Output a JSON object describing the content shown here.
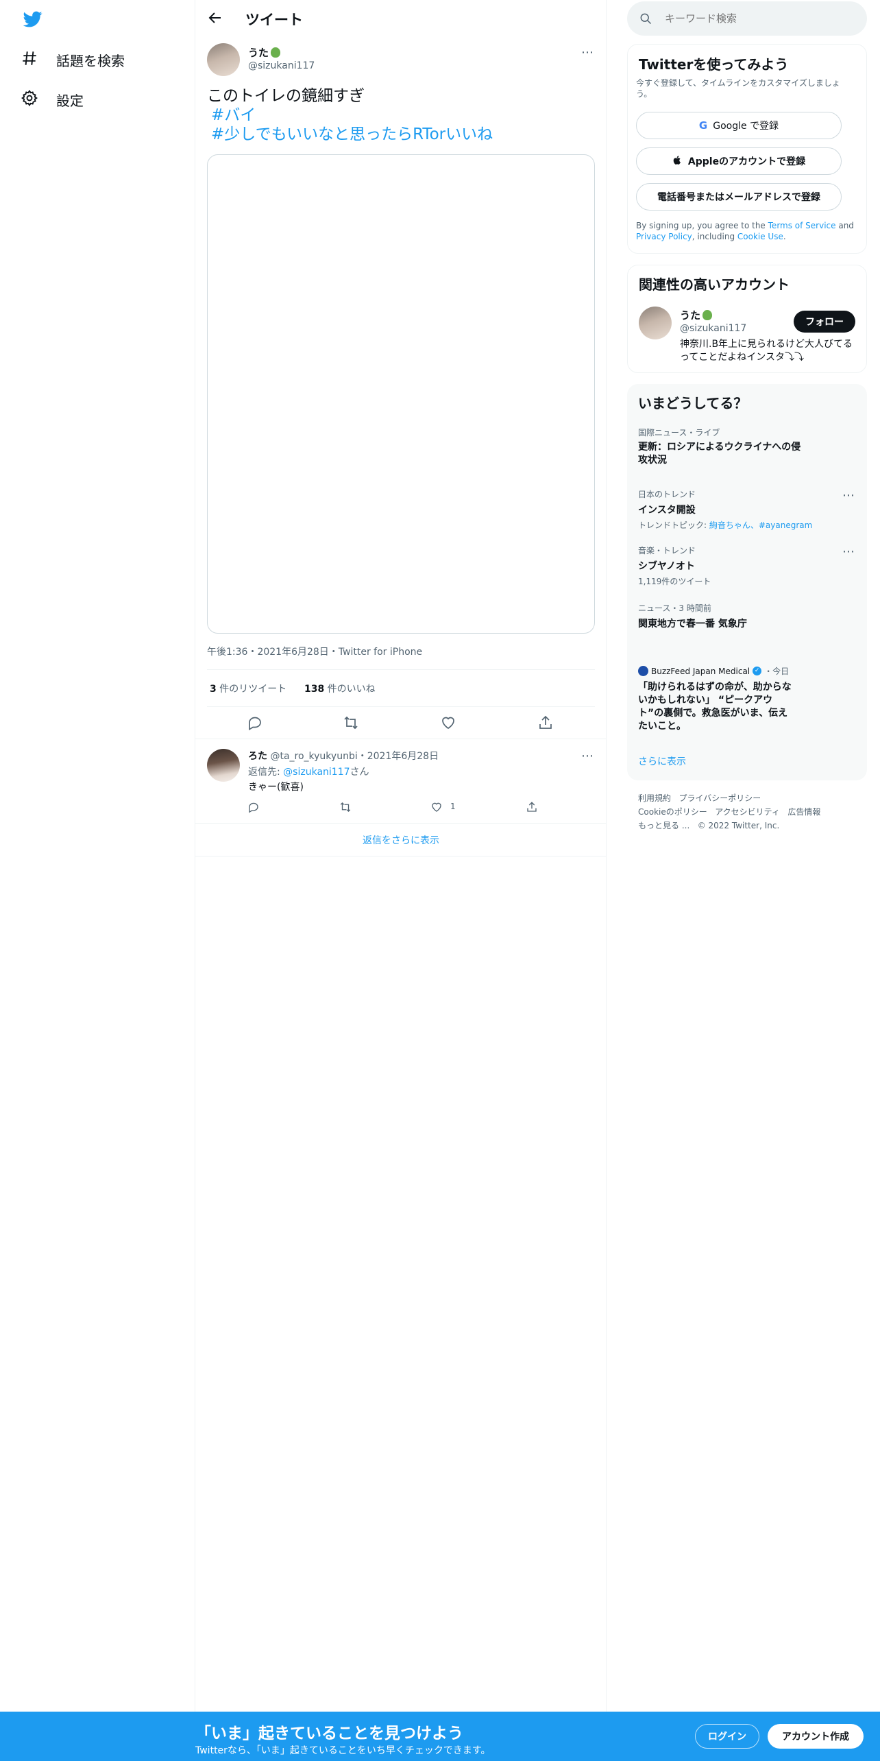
{
  "colors": {
    "accent": "#1d9bf0",
    "text": "#0f1419",
    "muted": "#536471",
    "border": "#eff3f4",
    "verified": "#1d9bf0"
  },
  "nav": {
    "logo": "twitter-bird-icon",
    "items": [
      {
        "icon": "hashtag-icon",
        "label": "話題を検索"
      },
      {
        "icon": "gear-icon",
        "label": "設定"
      }
    ]
  },
  "header": {
    "title": "ツイート"
  },
  "tweet": {
    "author": {
      "name": "うた",
      "handle": "@sizukani117"
    },
    "text_line1": "このトイレの鏡細すぎ",
    "hashtag1": "#バイ",
    "hashtag2": "#少しでもいいなと思ったらRTorいいね",
    "meta": "午後1:36・2021年6月28日・Twitter for iPhone",
    "retweet_count": "3",
    "retweet_label": " 件のリツイート",
    "like_count": "138",
    "like_label": " 件のいいね"
  },
  "reply": {
    "name": "ろた",
    "handle": "@ta_ro_kyukyunbi",
    "date": "・2021年6月28日",
    "reply_to_label": "返信先: ",
    "reply_to_handle": "@sizukani117",
    "reply_to_suffix": "さん",
    "text": "きゃー(歓喜)",
    "like_count": "1"
  },
  "show_more_replies": "返信をさらに表示",
  "search": {
    "placeholder": "キーワード検索"
  },
  "signup": {
    "title": "Twitterを使ってみよう",
    "subtitle": "今すぐ登録して、タイムラインをカスタマイズしましょう。",
    "google": "Google で登録",
    "apple": "Appleのアカウントで登録",
    "phone": "電話番号またはメールアドレスで登録",
    "terms_prefix": "By signing up, you agree to the ",
    "terms_link": "Terms of Service",
    "terms_and": " and ",
    "privacy_link": "Privacy Policy",
    "including": ", including ",
    "cookie_link": "Cookie Use",
    "period": "."
  },
  "related": {
    "title": "関連性の高いアカウント",
    "name": "うた",
    "handle": "@sizukani117",
    "follow": "フォロー",
    "bio": "神奈川.B年上に見られるけど大人びてるってことだよねインスタ⤵︎⤵︎"
  },
  "trends": {
    "title": "いまどうしてる？",
    "items": [
      {
        "context": "国際ニュース・ライブ",
        "title": "更新：ロシアによるウクライナへの侵攻状況"
      },
      {
        "context": "日本のトレンド",
        "title": "インスタ開設",
        "topic_label": "トレンドトピック: ",
        "topic_values": "絢音ちゃん、#ayanegram"
      },
      {
        "context": "音楽・トレンド",
        "title": "シブヤノオト",
        "count": "1,119件のツイート"
      },
      {
        "context": "ニュース・3 時間前",
        "title": "関東地方で春一番 気象庁"
      }
    ],
    "news": {
      "source": "BuzzFeed Japan Medical",
      "time": "・今日",
      "title": "「助けられるはずの命が、助からないかもしれない」 “ピークアウト”の裏側で。救急医がいま、伝えたいこと。"
    },
    "show_more": "さらに表示"
  },
  "footer": {
    "links_row1": [
      "利用規約",
      "プライバシーポリシー"
    ],
    "links_row2": [
      "Cookieのポリシー",
      "アクセシビリティ",
      "広告情報"
    ],
    "more": "もっと見る ...",
    "copyright": "© 2022 Twitter, Inc."
  },
  "bottom": {
    "title": "「いま」起きていることを見つけよう",
    "subtitle": "Twitterなら、「いま」起きていることをいち早くチェックできます。",
    "login": "ログイン",
    "signup": "アカウント作成"
  }
}
